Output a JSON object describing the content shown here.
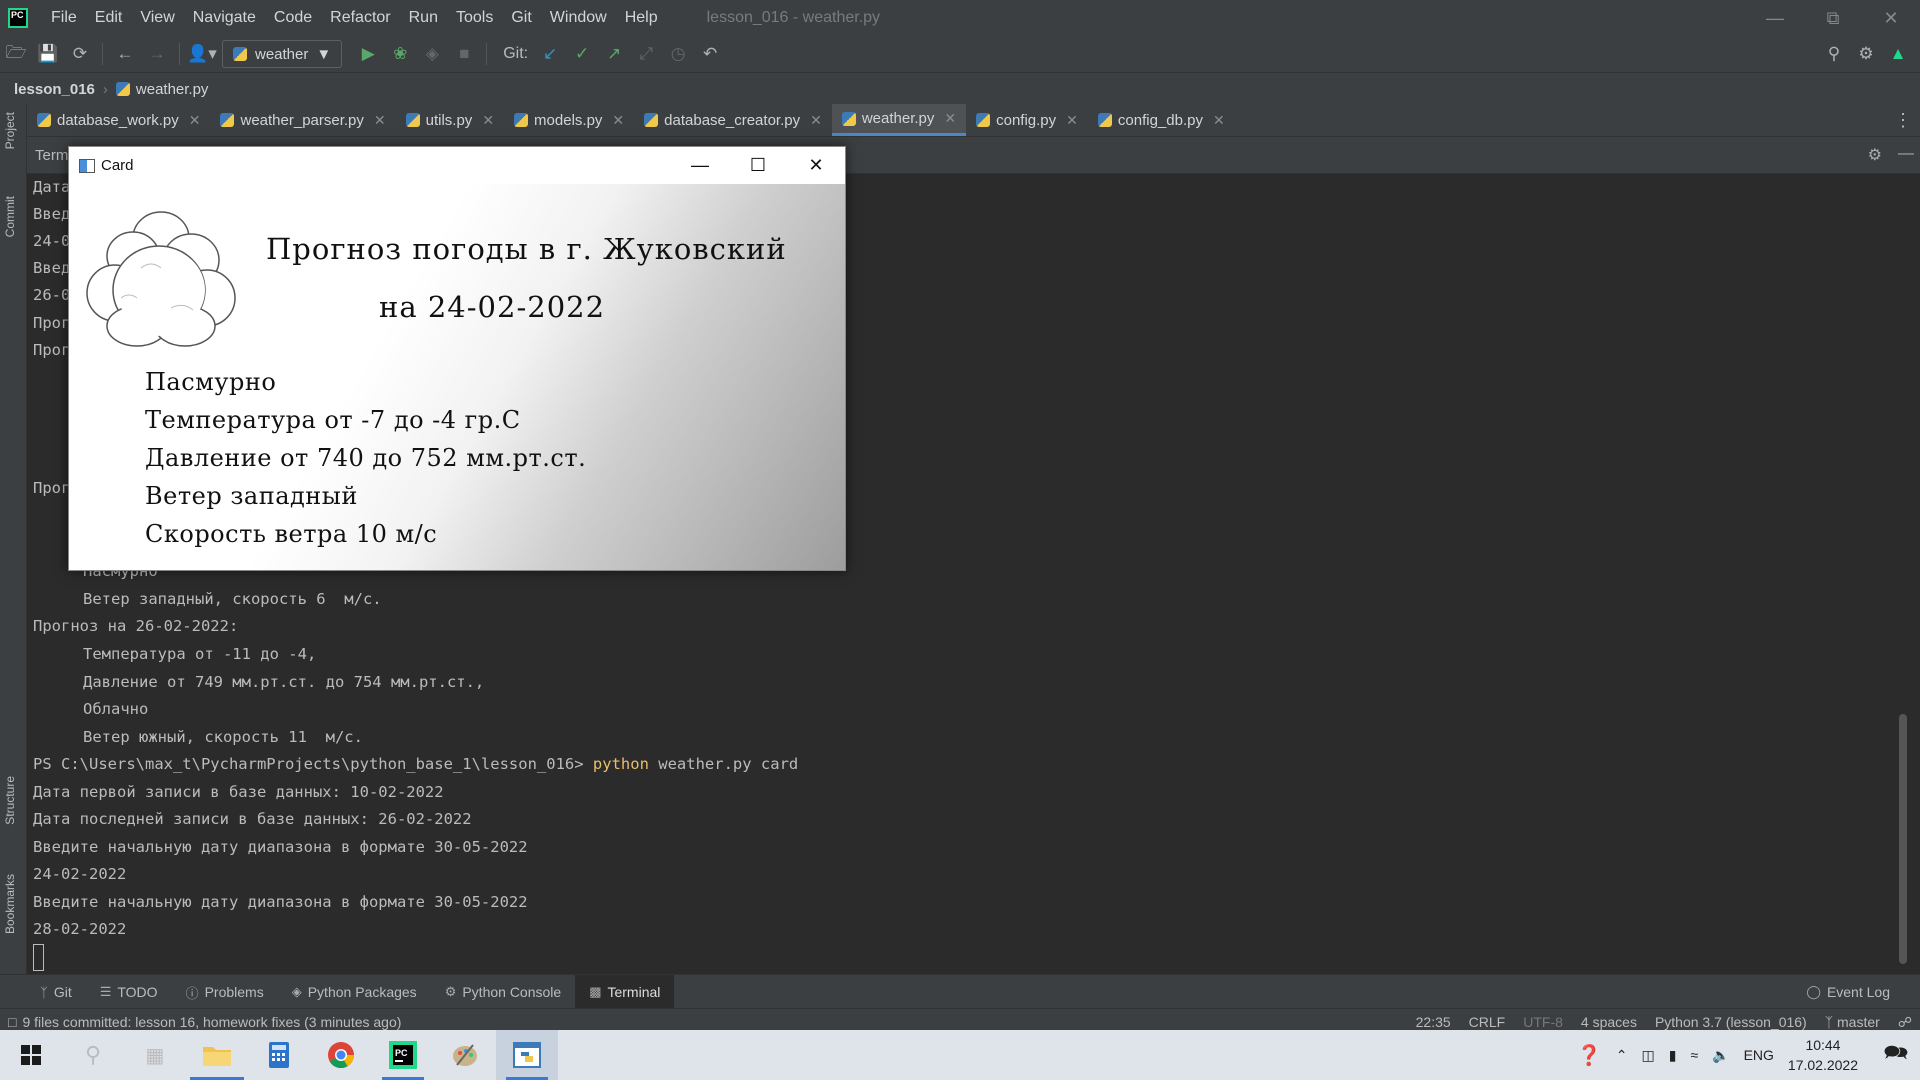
{
  "menubar": {
    "items": [
      "File",
      "Edit",
      "View",
      "Navigate",
      "Code",
      "Refactor",
      "Run",
      "Tools",
      "Git",
      "Window",
      "Help"
    ],
    "window_title": "lesson_016 - weather.py"
  },
  "toolbar": {
    "run_config": "weather",
    "git_label": "Git:"
  },
  "breadcrumb": {
    "project": "lesson_016",
    "file": "weather.py"
  },
  "left_stripe": {
    "labels": [
      "Project",
      "Commit",
      "Structure",
      "Bookmarks"
    ]
  },
  "tabs": [
    {
      "label": "database_work.py"
    },
    {
      "label": "weather_parser.py"
    },
    {
      "label": "utils.py"
    },
    {
      "label": "models.py"
    },
    {
      "label": "database_creator.py"
    },
    {
      "label": "weather.py"
    },
    {
      "label": "config.py"
    },
    {
      "label": "config_db.py"
    }
  ],
  "terminal": {
    "header": "Term",
    "partial_lines": [
      "Дата",
      "Введ",
      "24-0",
      "Введ",
      "26-0",
      "Прог",
      "Прог",
      "Прог"
    ],
    "lines": [
      "Пасмурно",
      "Ветер западный, скорость 6  м/с.",
      "Прогноз на 26-02-2022:",
      "Температура от -11 до -4,",
      "Давление от 749 мм.рт.ст. до 754 мм.рт.ст.,",
      "Облачно",
      "Ветер южный, скорость 11  м/с.",
      "Дата первой записи в базе данных: 10-02-2022",
      "Дата последней записи в базе данных: 26-02-2022",
      "Введите начальную дату диапазона в формате 30-05-2022",
      "24-02-2022",
      "Введите начальную дату диапазона в формате 30-05-2022",
      "28-02-2022"
    ],
    "prompt": "PS C:\\Users\\max_t\\PycharmProjects\\python_base_1\\lesson_016> ",
    "cmd_python": "python",
    "cmd_rest": " weather.py card"
  },
  "card": {
    "window_title": "Card",
    "title": "Прогноз погоды в г. Жуковский",
    "date_line": "на 24-02-2022",
    "lines": [
      "Пасмурно",
      "Температура от -7  до -4 гр.С",
      "Давление от 740 до 752 мм.рт.ст.",
      "Ветер западный",
      "Скорость ветра 10  м/с"
    ]
  },
  "tool_windows": [
    {
      "label": "Git",
      "icon": "git-branch-icon"
    },
    {
      "label": "TODO",
      "icon": "list-icon"
    },
    {
      "label": "Problems",
      "icon": "info-icon"
    },
    {
      "label": "Python Packages",
      "icon": "package-icon"
    },
    {
      "label": "Python Console",
      "icon": "python-console-icon"
    },
    {
      "label": "Terminal",
      "icon": "terminal-icon"
    }
  ],
  "event_log": "Event Log",
  "statusbar": {
    "message": "9 files committed: lesson 16, homework fixes (3 minutes ago)",
    "position": "22:35",
    "line_sep": "CRLF",
    "encoding": "UTF-8",
    "indent": "4 spaces",
    "interpreter": "Python 3.7 (lesson_016)",
    "branch": "master"
  },
  "taskbar": {
    "lang": "ENG",
    "time": "10:44",
    "date": "17.02.2022"
  }
}
